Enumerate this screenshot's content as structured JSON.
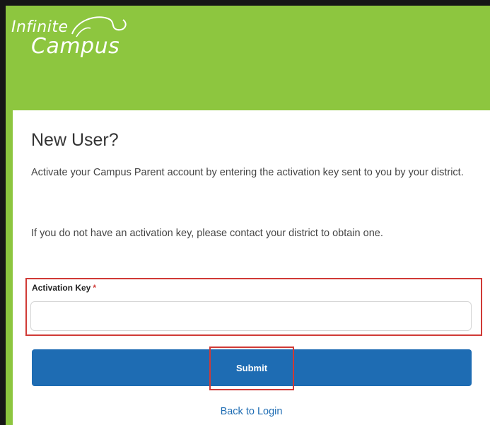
{
  "brand": {
    "line1": "Infinite",
    "line2": "Campus"
  },
  "card": {
    "title": "New User?",
    "paragraph1": "Activate your Campus Parent account by entering the activation key sent to you by your district.",
    "paragraph2": "If you do not have an activation key, please contact your district to obtain one."
  },
  "form": {
    "activation_label": "Activation Key",
    "required_mark": "*",
    "activation_value": "",
    "submit_label": "Submit",
    "back_link": "Back to Login"
  },
  "colors": {
    "brand_green": "#8dc63f",
    "button_blue": "#1e6cb3",
    "highlight_red": "#d03a36"
  }
}
